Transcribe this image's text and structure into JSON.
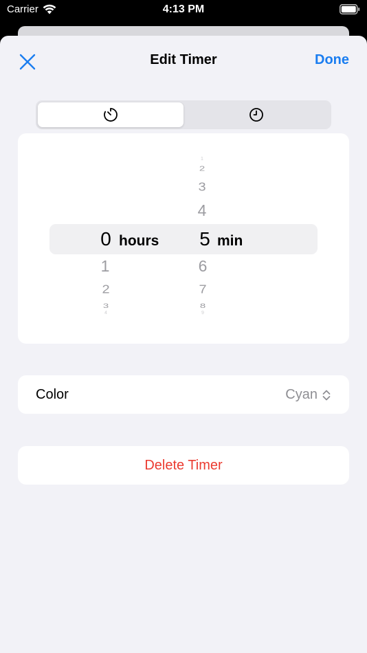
{
  "status_bar": {
    "carrier": "Carrier",
    "time": "4:13 PM"
  },
  "nav": {
    "title": "Edit Timer",
    "done_label": "Done",
    "close_icon": "close-icon"
  },
  "segmented": {
    "options": [
      {
        "icon": "timer-icon",
        "selected": true
      },
      {
        "icon": "clock-icon",
        "selected": false
      }
    ]
  },
  "picker": {
    "hours": {
      "above": [],
      "selected": "0",
      "below": [
        "1",
        "2",
        "3",
        "4"
      ],
      "unit": "hours"
    },
    "minutes": {
      "above": [
        "1",
        "2",
        "3",
        "4"
      ],
      "selected": "5",
      "below": [
        "6",
        "7",
        "8",
        "9"
      ],
      "unit": "min"
    }
  },
  "color_row": {
    "label": "Color",
    "value": "Cyan",
    "icon": "chevron-up-down-icon"
  },
  "delete_row": {
    "label": "Delete Timer"
  },
  "colors": {
    "accent": "#1a7df0",
    "destructive": "#eb3b30",
    "secondary_text": "#8e8e93",
    "background": "#f2f2f7"
  }
}
